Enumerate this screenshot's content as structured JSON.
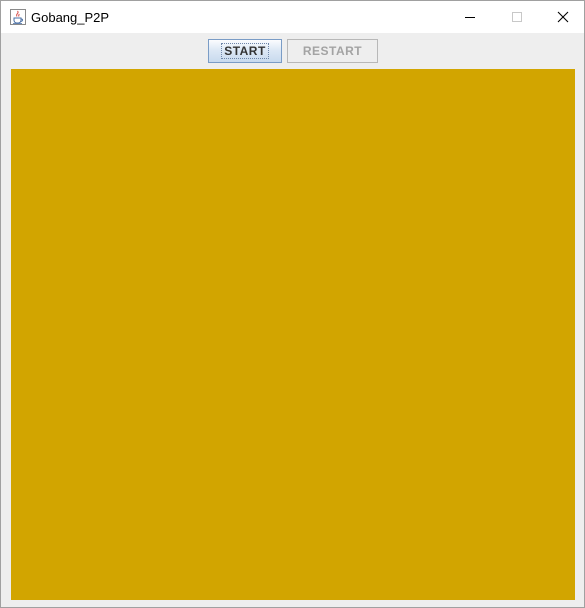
{
  "window": {
    "title": "Gobang_P2P",
    "icon": "java-cup-icon",
    "controls": [
      "minimize-icon",
      "maximize-icon",
      "close-icon"
    ]
  },
  "toolbar": {
    "start_label": "START",
    "restart_label": "RESTART",
    "start_state": "focused",
    "restart_state": "disabled"
  },
  "board": {
    "color": "#d2a500"
  }
}
